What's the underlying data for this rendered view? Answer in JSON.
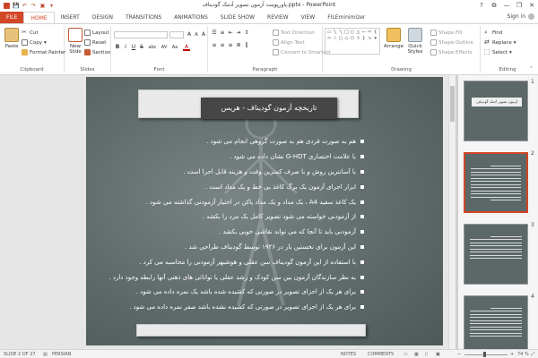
{
  "titlebar": {
    "title": "پاورپوینت آزمون تصویر آدمک گودیناف.pptx - PowerPoint",
    "app_icon": "P",
    "qat": [
      "save-icon",
      "undo-icon",
      "redo-icon",
      "start-slideshow-icon"
    ],
    "controls": [
      "?",
      "⧉",
      "—",
      "❐",
      "✕"
    ]
  },
  "tabs": {
    "items": [
      "FILE",
      "HOME",
      "INSERT",
      "DESIGN",
      "TRANSITIONS",
      "ANIMATIONS",
      "SLIDE SHOW",
      "REVIEW",
      "VIEW",
      "FILEminimizer"
    ],
    "active": "HOME",
    "signin": "Sign in"
  },
  "ribbon": {
    "clipboard": {
      "label": "Clipboard",
      "paste": "Paste",
      "cut": "Cut",
      "copy": "Copy",
      "format_painter": "Format Painter"
    },
    "slides": {
      "label": "Slides",
      "new_slide": "New Slide",
      "layout": "Layout",
      "reset": "Reset",
      "section": "Section"
    },
    "font": {
      "label": "Font",
      "bold": "B",
      "italic": "I",
      "underline": "U",
      "strike": "S",
      "shadow": "abc",
      "spacing": "AV",
      "case": "Aa",
      "color": "A",
      "grow": "A",
      "shrink": "A",
      "clear": "A"
    },
    "paragraph": {
      "label": "Paragraph",
      "text_direction": "Text Direction",
      "align_text": "Align Text",
      "convert_smartart": "Convert to SmartArt"
    },
    "drawing": {
      "label": "Drawing",
      "arrange": "Arrange",
      "quick_styles": "Quick Styles",
      "shape_fill": "Shape Fill",
      "shape_outline": "Shape Outline",
      "shape_effects": "Shape Effects"
    },
    "editing": {
      "label": "Editing",
      "find": "Find",
      "replace": "Replace",
      "select": "Select"
    }
  },
  "slide": {
    "title": "تاریخچه آزمون گودیناف - هریس",
    "bullets": [
      "هم به صورت فردی هم به صورت گروهی انجام می شود .",
      "با علامت اختصاری G-HDT نشان داده می شود .",
      "با آسانترین روش و با صرف کمترین وقت و هزینه قابل اجرا است .",
      "ابزار اجرای آزمون یک برگ کاغذ بی خط و یک مداد است .",
      "یک کاغذ سفید A4 ، یک مداد و یک مداد پاکن در اختیار آزمودنی گذاشته می شود .",
      "از آزمودنی خواسته می شود تصویر کامل یک مرد را بکشد .",
      "آزمودنی باید تا آنجا که می تواند نقاشی خوبی بکشد .",
      "این آزمون برای نخستین بار در ۱۹۲۶ توسط گودیناف طراحی شد .",
      "با استفاده از این آزمون گودیناف سن عقلی و هوشبهر آزمودنی را محاسبه می کرد .",
      "به نظر سازندگان آزمون بین سن کودک و رشد عقلی یا توانائی های ذهنی آنها رابطه وجود دارد .",
      "برای هر یک از اجزای تصویر در صورتی که کشیده شده باشد یک نمره داده می شود .",
      "برای هر یک از اجزای تصویر در صورتی که کشیده نشده باشد صفر نمره داده می شود ."
    ]
  },
  "thumbnails": [
    {
      "num": "1",
      "title": "آزمون تصویر آدمک گودیناف"
    },
    {
      "num": "2",
      "title": ""
    },
    {
      "num": "3",
      "title": ""
    },
    {
      "num": "4",
      "title": ""
    }
  ],
  "statusbar": {
    "slide_count": "SLIDE 2 OF 27",
    "language": "PERSIAN",
    "notes": "NOTES",
    "comments": "COMMENTS",
    "zoom": "74 %"
  }
}
